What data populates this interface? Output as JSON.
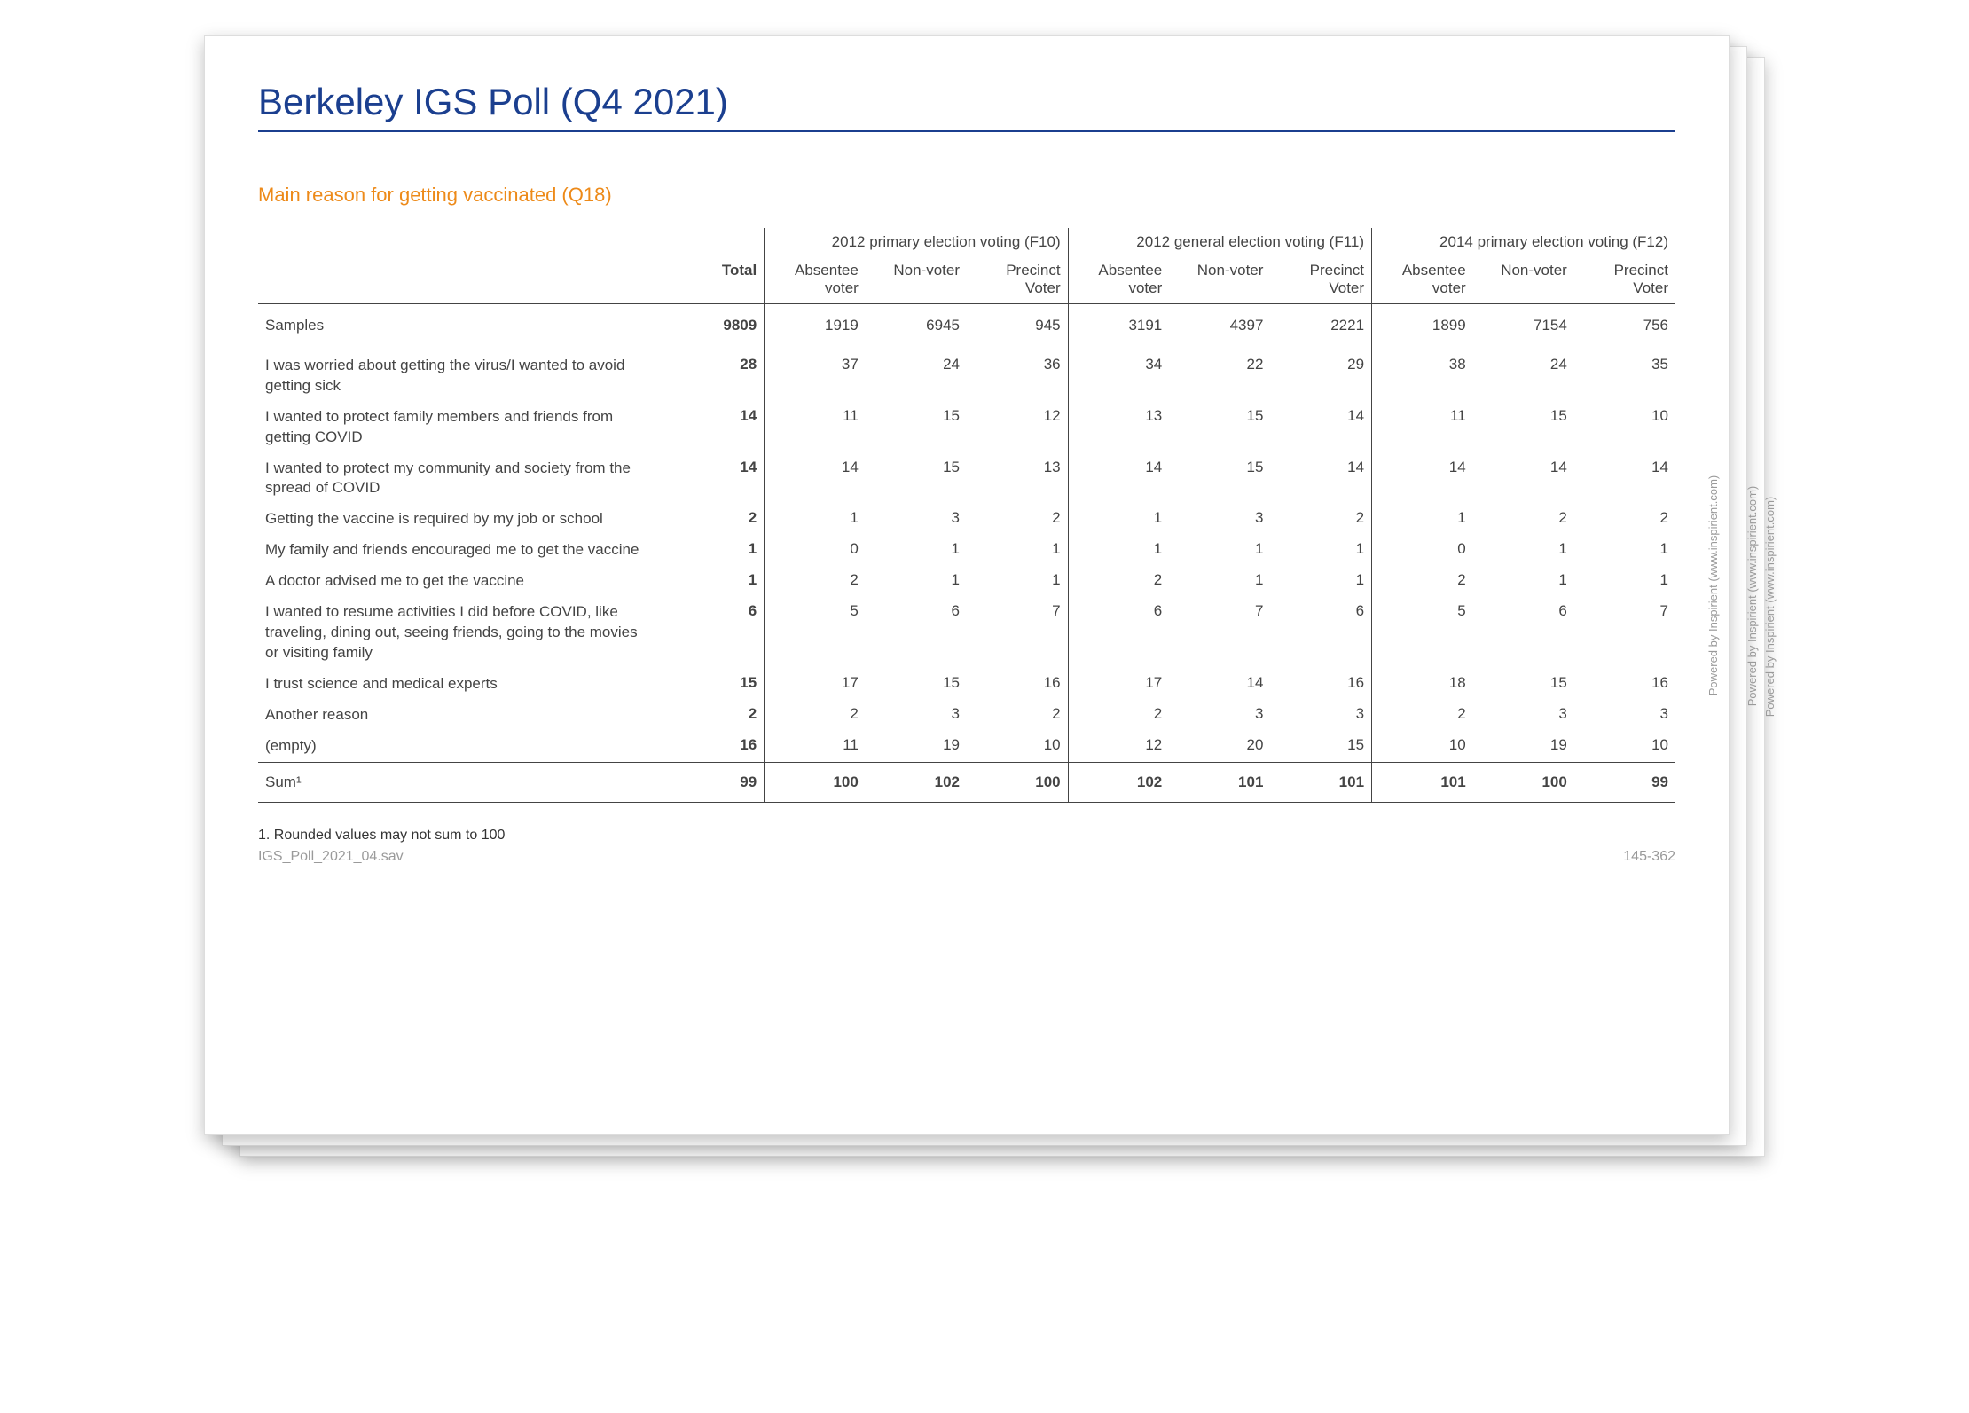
{
  "title": "Berkeley IGS Poll (Q4 2021)",
  "subtitle": "Main reason for getting vaccinated (Q18)",
  "side_caption": "Powered by Inspirient (www.inspirient.com)",
  "footnote": "1. Rounded values may not sum to 100",
  "footer_left": "IGS_Poll_2021_04.sav",
  "footer_right": "145-362",
  "columns": {
    "total_label": "Total",
    "groups": [
      {
        "title": "2012 primary election voting (F10)",
        "subs": [
          "Absentee voter",
          "Non-voter",
          "Precinct Voter"
        ]
      },
      {
        "title": "2012 general election voting (F11)",
        "subs": [
          "Absentee voter",
          "Non-voter",
          "Precinct Voter"
        ]
      },
      {
        "title": "2014 primary election voting (F12)",
        "subs": [
          "Absentee voter",
          "Non-voter",
          "Precinct Voter"
        ]
      }
    ]
  },
  "rows": {
    "samples_label": "Samples",
    "samples": {
      "total": "9809",
      "v": [
        "1919",
        "6945",
        "945",
        "3191",
        "4397",
        "2221",
        "1899",
        "7154",
        "756"
      ]
    },
    "body": [
      {
        "label": "I was worried about getting the virus/I wanted to avoid getting sick",
        "total": "28",
        "v": [
          "37",
          "24",
          "36",
          "34",
          "22",
          "29",
          "38",
          "24",
          "35"
        ]
      },
      {
        "label": "I wanted to protect family members and friends from getting COVID",
        "total": "14",
        "v": [
          "11",
          "15",
          "12",
          "13",
          "15",
          "14",
          "11",
          "15",
          "10"
        ]
      },
      {
        "label": "I wanted to protect my community and society from the spread of COVID",
        "total": "14",
        "v": [
          "14",
          "15",
          "13",
          "14",
          "15",
          "14",
          "14",
          "14",
          "14"
        ]
      },
      {
        "label": "Getting the vaccine is required by my job or school",
        "total": "2",
        "v": [
          "1",
          "3",
          "2",
          "1",
          "3",
          "2",
          "1",
          "2",
          "2"
        ]
      },
      {
        "label": "My family and friends encouraged me to get the vaccine",
        "total": "1",
        "v": [
          "0",
          "1",
          "1",
          "1",
          "1",
          "1",
          "0",
          "1",
          "1"
        ]
      },
      {
        "label": "A doctor advised me to get the vaccine",
        "total": "1",
        "v": [
          "2",
          "1",
          "1",
          "2",
          "1",
          "1",
          "2",
          "1",
          "1"
        ]
      },
      {
        "label": "I wanted to resume activities I did before COVID, like traveling, dining out, seeing friends, going to the movies or visiting family",
        "total": "6",
        "v": [
          "5",
          "6",
          "7",
          "6",
          "7",
          "6",
          "5",
          "6",
          "7"
        ]
      },
      {
        "label": "I trust science and medical experts",
        "total": "15",
        "v": [
          "17",
          "15",
          "16",
          "17",
          "14",
          "16",
          "18",
          "15",
          "16"
        ]
      },
      {
        "label": "Another reason",
        "total": "2",
        "v": [
          "2",
          "3",
          "2",
          "2",
          "3",
          "3",
          "2",
          "3",
          "3"
        ]
      },
      {
        "label": "(empty)",
        "total": "16",
        "v": [
          "11",
          "19",
          "10",
          "12",
          "20",
          "15",
          "10",
          "19",
          "10"
        ]
      }
    ],
    "sum_label": "Sum¹",
    "sum": {
      "total": "99",
      "v": [
        "100",
        "102",
        "100",
        "102",
        "101",
        "101",
        "101",
        "100",
        "99"
      ]
    }
  }
}
